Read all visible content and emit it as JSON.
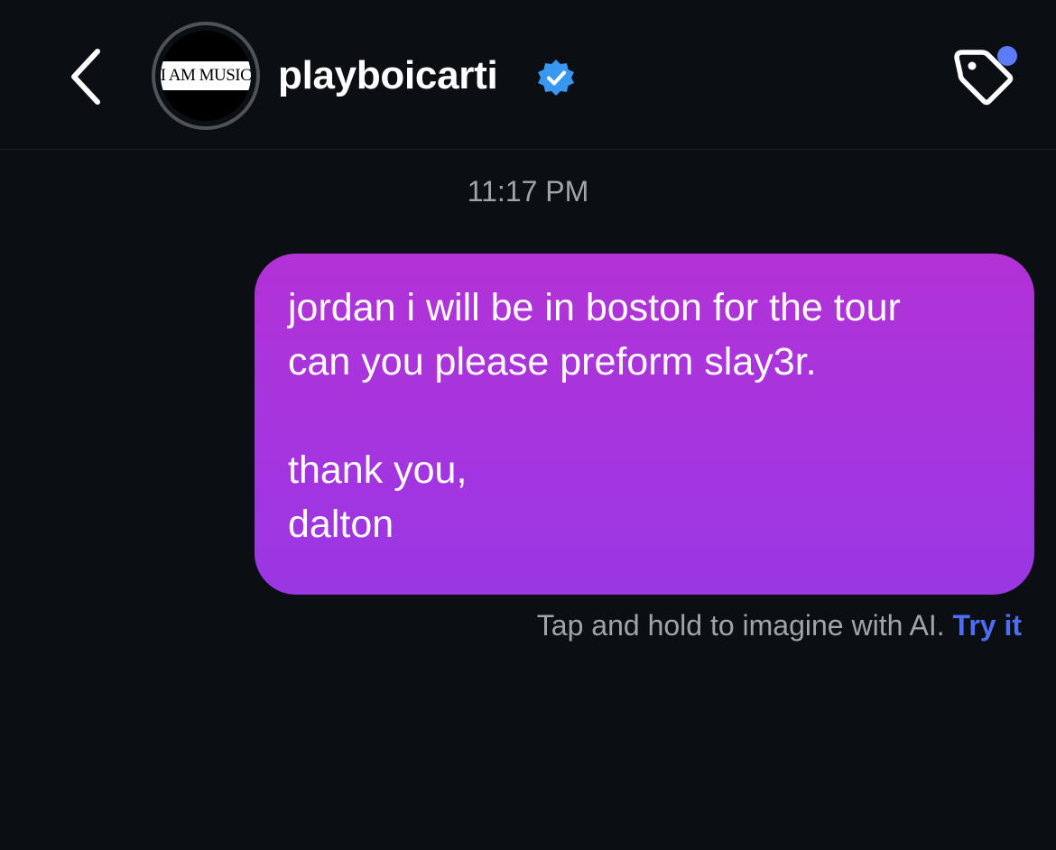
{
  "header": {
    "username": "playboicarti",
    "avatar_text": "I AM MUSIC",
    "verified_icon": "verified-badge-icon",
    "back_icon": "chevron-left-icon",
    "tag_icon": "tag-icon",
    "notification_dot_color": "#5b7cf6",
    "verified_color": "#3897f0"
  },
  "conversation": {
    "timestamp": "11:17 PM",
    "message": {
      "text": "jordan i will be in boston for the tour\ncan you please preform slay3r.\n\nthank you,\ndalton",
      "bubble_color": "#a535df"
    },
    "hint": {
      "text": "Tap and hold to imagine with AI.",
      "link": "Try it",
      "link_color": "#4e6cf4"
    }
  },
  "theme": {
    "background": "#0b0f14"
  }
}
